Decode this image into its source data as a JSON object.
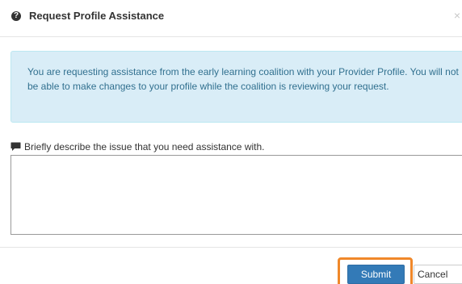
{
  "dialog": {
    "title": "Request Profile Assistance",
    "title_icon": "question-circle-icon",
    "close_label": "×",
    "alert_text": "You are requesting assistance from the early learning coalition with your Provider Profile. You will not be able to make changes to your profile while the coalition is reviewing your request.",
    "field_icon": "comment-icon",
    "field_label": "Briefly describe the issue that you need assistance with.",
    "field_value": "",
    "submit_label": "Submit",
    "cancel_label": "Cancel"
  },
  "colors": {
    "alert_background": "#d9edf7",
    "alert_text": "#31708f",
    "primary_button": "#337ab7",
    "highlight_outline": "#f0882a"
  }
}
